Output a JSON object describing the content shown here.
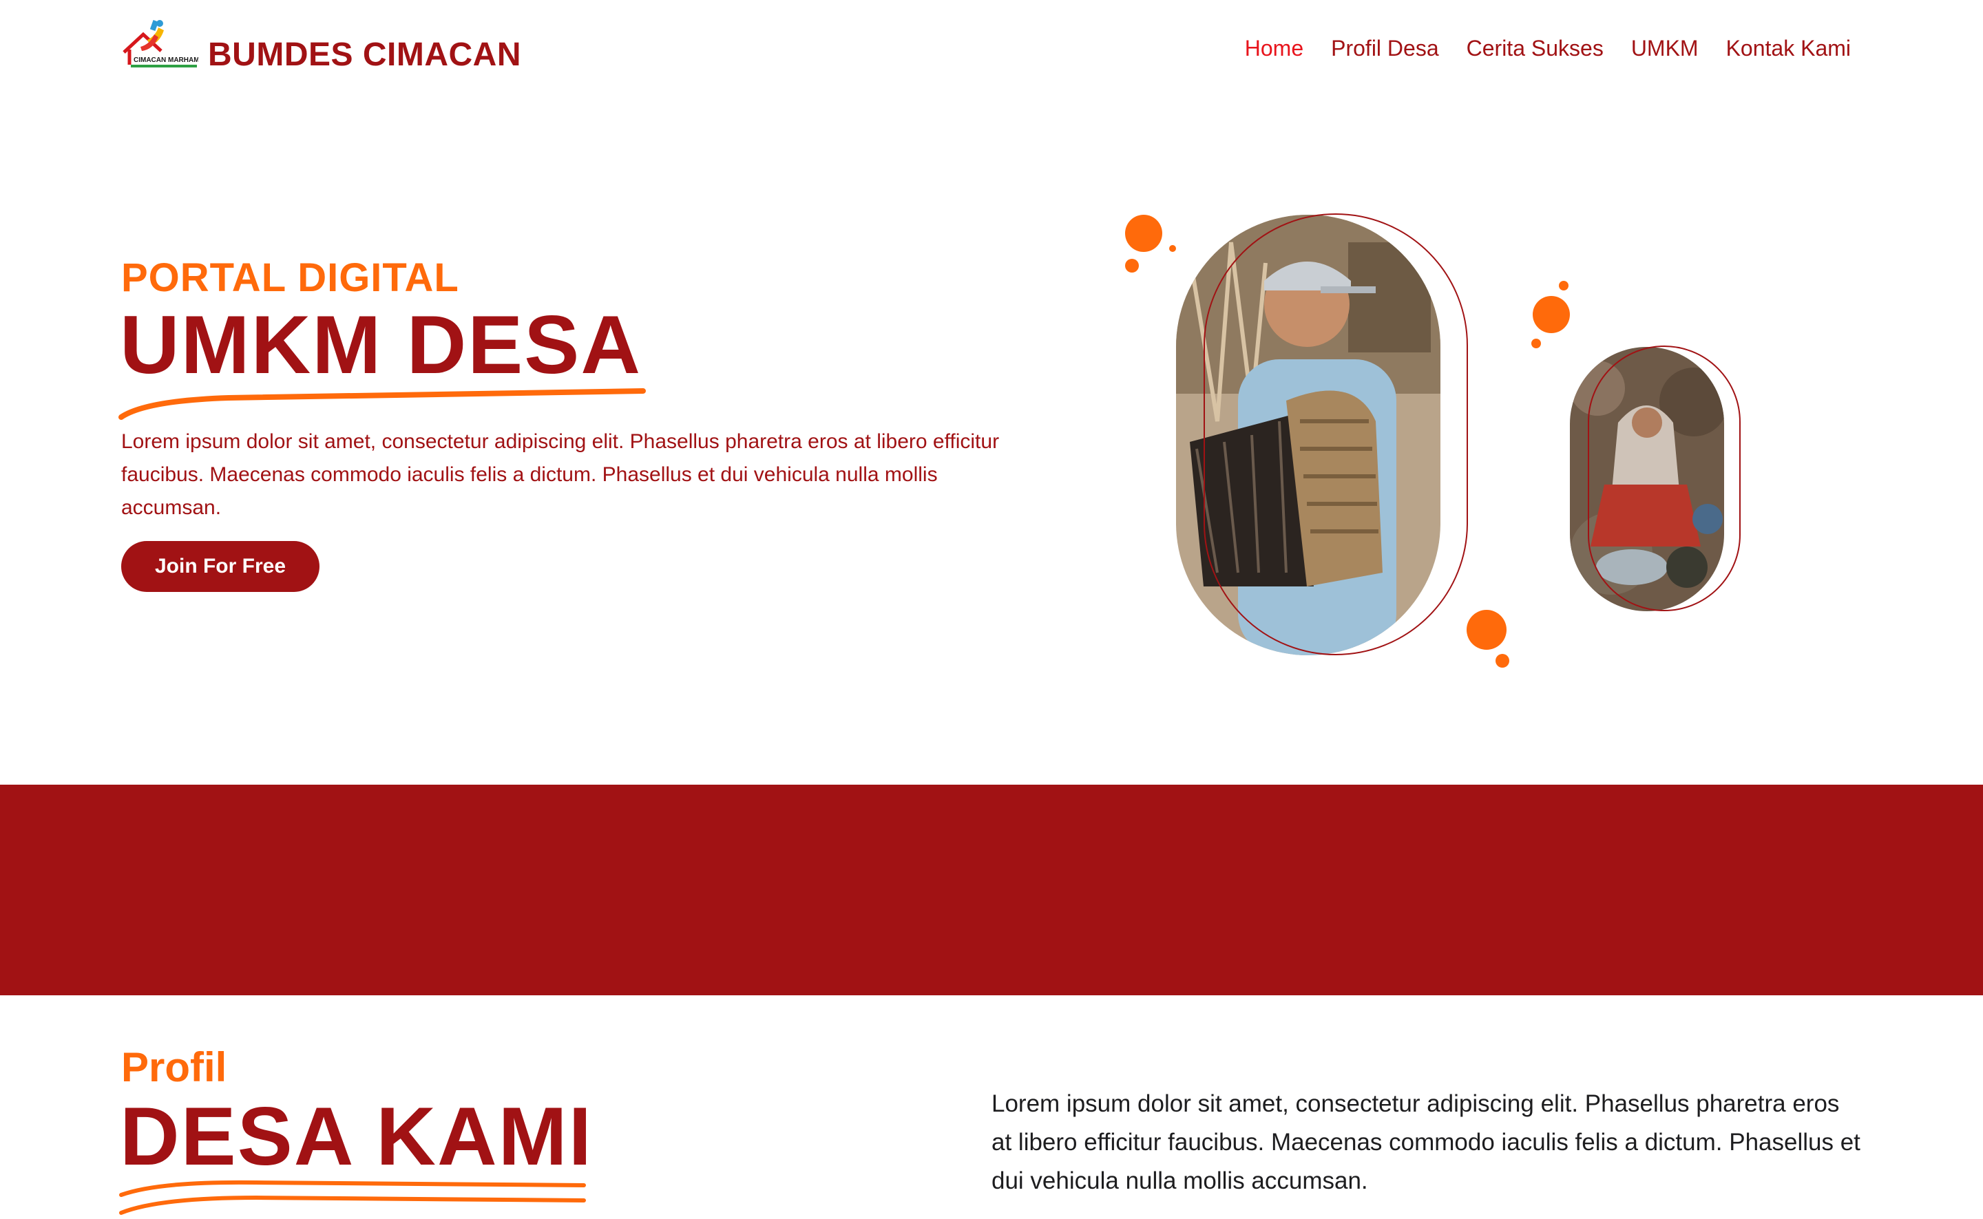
{
  "header": {
    "brand": "BUMDES CIMACAN",
    "logo_text": "CIMACAN MARHAMAH",
    "nav": [
      {
        "label": "Home",
        "active": true
      },
      {
        "label": "Profil Desa",
        "active": false
      },
      {
        "label": "Cerita Sukses",
        "active": false
      },
      {
        "label": "UMKM",
        "active": false
      },
      {
        "label": "Kontak Kami",
        "active": false
      }
    ]
  },
  "hero": {
    "eyebrow": "PORTAL DIGITAL",
    "title": "UMKM DESA",
    "description": "Lorem ipsum dolor sit amet, consectetur adipiscing elit. Phasellus pharetra eros at libero efficitur faucibus. Maecenas commodo iaculis felis a dictum. Phasellus et dui vehicula nulla mollis accumsan.",
    "cta_label": "Join For Free"
  },
  "profil": {
    "eyebrow": "Profil",
    "title": "DESA KAMI",
    "description": "Lorem ipsum dolor sit amet, consectetur adipiscing elit. Phasellus pharetra eros at libero efficitur faucibus. Maecenas commodo iaculis felis a dictum. Phasellus et dui vehicula nulla mollis accumsan."
  },
  "colors": {
    "brand_red": "#a11214",
    "accent_orange": "#ff6a0b",
    "active_nav": "#e8141c",
    "background": "#ffffff"
  }
}
